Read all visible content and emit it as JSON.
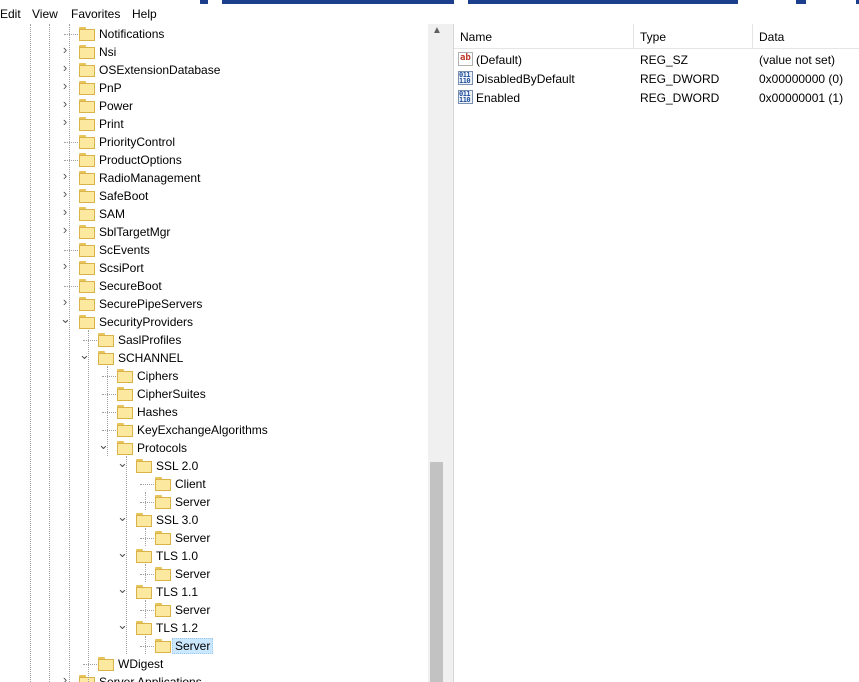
{
  "menu": {
    "items": [
      "Edit",
      "View",
      "Favorites",
      "Help"
    ]
  },
  "tree": {
    "rows": [
      {
        "label": "Notifications",
        "level": 0,
        "exp": "none"
      },
      {
        "label": "Nsi",
        "level": 0,
        "exp": "collapsed"
      },
      {
        "label": "OSExtensionDatabase",
        "level": 0,
        "exp": "collapsed"
      },
      {
        "label": "PnP",
        "level": 0,
        "exp": "collapsed"
      },
      {
        "label": "Power",
        "level": 0,
        "exp": "collapsed"
      },
      {
        "label": "Print",
        "level": 0,
        "exp": "collapsed"
      },
      {
        "label": "PriorityControl",
        "level": 0,
        "exp": "none"
      },
      {
        "label": "ProductOptions",
        "level": 0,
        "exp": "none"
      },
      {
        "label": "RadioManagement",
        "level": 0,
        "exp": "collapsed"
      },
      {
        "label": "SafeBoot",
        "level": 0,
        "exp": "collapsed"
      },
      {
        "label": "SAM",
        "level": 0,
        "exp": "collapsed"
      },
      {
        "label": "SblTargetMgr",
        "level": 0,
        "exp": "collapsed"
      },
      {
        "label": "ScEvents",
        "level": 0,
        "exp": "none"
      },
      {
        "label": "ScsiPort",
        "level": 0,
        "exp": "collapsed"
      },
      {
        "label": "SecureBoot",
        "level": 0,
        "exp": "none"
      },
      {
        "label": "SecurePipeServers",
        "level": 0,
        "exp": "collapsed"
      },
      {
        "label": "SecurityProviders",
        "level": 0,
        "exp": "expanded"
      },
      {
        "label": "SaslProfiles",
        "level": 1,
        "exp": "none"
      },
      {
        "label": "SCHANNEL",
        "level": 1,
        "exp": "expanded"
      },
      {
        "label": "Ciphers",
        "level": 2,
        "exp": "none"
      },
      {
        "label": "CipherSuites",
        "level": 2,
        "exp": "none"
      },
      {
        "label": "Hashes",
        "level": 2,
        "exp": "none"
      },
      {
        "label": "KeyExchangeAlgorithms",
        "level": 2,
        "exp": "none"
      },
      {
        "label": "Protocols",
        "level": 2,
        "exp": "expanded"
      },
      {
        "label": "SSL 2.0",
        "level": 3,
        "exp": "expanded"
      },
      {
        "label": "Client",
        "level": 4,
        "exp": "none"
      },
      {
        "label": "Server",
        "level": 4,
        "exp": "none"
      },
      {
        "label": "SSL 3.0",
        "level": 3,
        "exp": "expanded"
      },
      {
        "label": "Server",
        "level": 4,
        "exp": "none"
      },
      {
        "label": "TLS 1.0",
        "level": 3,
        "exp": "expanded"
      },
      {
        "label": "Server",
        "level": 4,
        "exp": "none"
      },
      {
        "label": "TLS 1.1",
        "level": 3,
        "exp": "expanded"
      },
      {
        "label": "Server",
        "level": 4,
        "exp": "none"
      },
      {
        "label": "TLS 1.2",
        "level": 3,
        "exp": "expanded"
      },
      {
        "label": "Server",
        "level": 4,
        "exp": "none",
        "selected": true
      },
      {
        "label": "WDigest",
        "level": 1,
        "exp": "none"
      },
      {
        "label": "Server Applications",
        "level": 0,
        "exp": "collapsed"
      }
    ]
  },
  "list": {
    "columns": [
      "Name",
      "Type",
      "Data"
    ],
    "rows": [
      {
        "icon": "string-value-icon",
        "name": "(Default)",
        "type": "REG_SZ",
        "data": "(value not set)"
      },
      {
        "icon": "dword-value-icon",
        "name": "DisabledByDefault",
        "type": "REG_DWORD",
        "data": "0x00000000 (0)"
      },
      {
        "icon": "dword-value-icon",
        "name": "Enabled",
        "type": "REG_DWORD",
        "data": "0x00000001 (1)"
      }
    ]
  },
  "icons": {
    "string_glyph": "ab",
    "dword_glyph_top": "011",
    "dword_glyph_bottom": "110"
  },
  "colors": {
    "selection": "#cce8ff",
    "folder": "#fde8a0",
    "title_accent": "#1b3f8c"
  }
}
